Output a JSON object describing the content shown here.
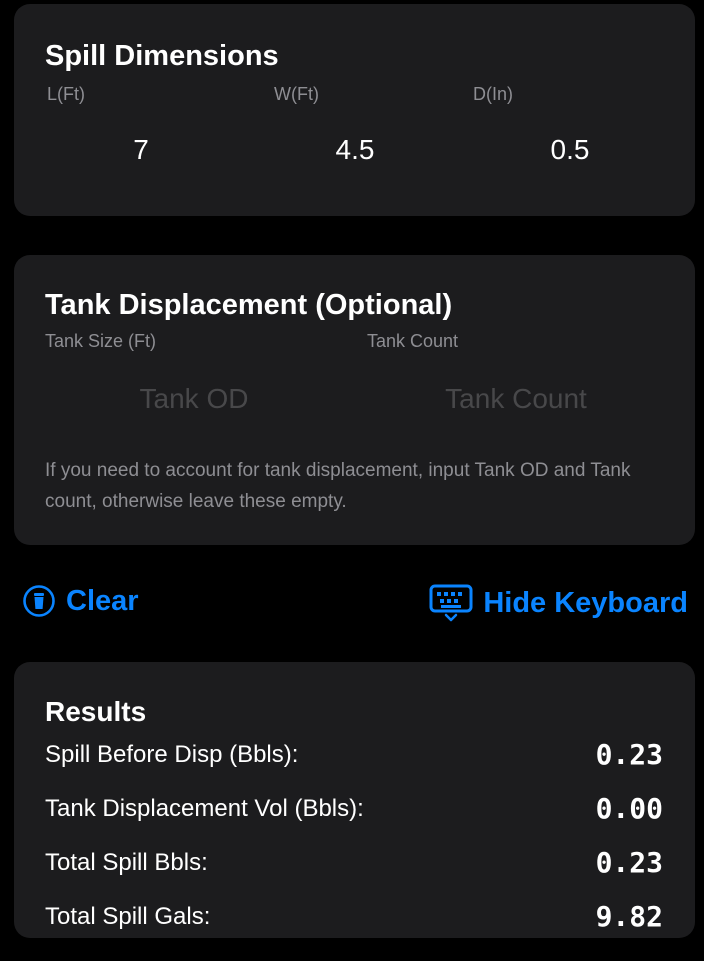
{
  "spill": {
    "title": "Spill Dimensions",
    "length_label": "L(Ft)",
    "width_label": "W(Ft)",
    "depth_label": "D(In)",
    "length_value": "7",
    "width_value": "4.5",
    "depth_value": "0.5"
  },
  "tank": {
    "title": "Tank Displacement (Optional)",
    "size_label": "Tank Size (Ft)",
    "count_label": "Tank Count",
    "od_placeholder": "Tank OD",
    "count_placeholder": "Tank Count",
    "od_value": "",
    "count_value": "",
    "hint": "If you need to account for tank displacement, input Tank OD and Tank count, otherwise leave these empty."
  },
  "actions": {
    "clear_label": "Clear",
    "clear_icon": "trash-circle-icon",
    "hide_keyboard_label": "Hide Keyboard",
    "hide_keyboard_icon": "keyboard-chevron-down-icon"
  },
  "results": {
    "title": "Results",
    "rows": [
      {
        "label": "Spill Before Disp (Bbls):",
        "value": "0.23"
      },
      {
        "label": "Tank Displacement Vol (Bbls):",
        "value": "0.00"
      },
      {
        "label": "Total Spill Bbls:",
        "value": "0.23"
      },
      {
        "label": "Total Spill Gals:",
        "value": "9.82"
      }
    ]
  },
  "colors": {
    "background": "#000000",
    "card": "#1c1c1e",
    "accent": "#0a84ff",
    "secondary_text": "#8e8e93",
    "placeholder_text": "#48484a"
  }
}
